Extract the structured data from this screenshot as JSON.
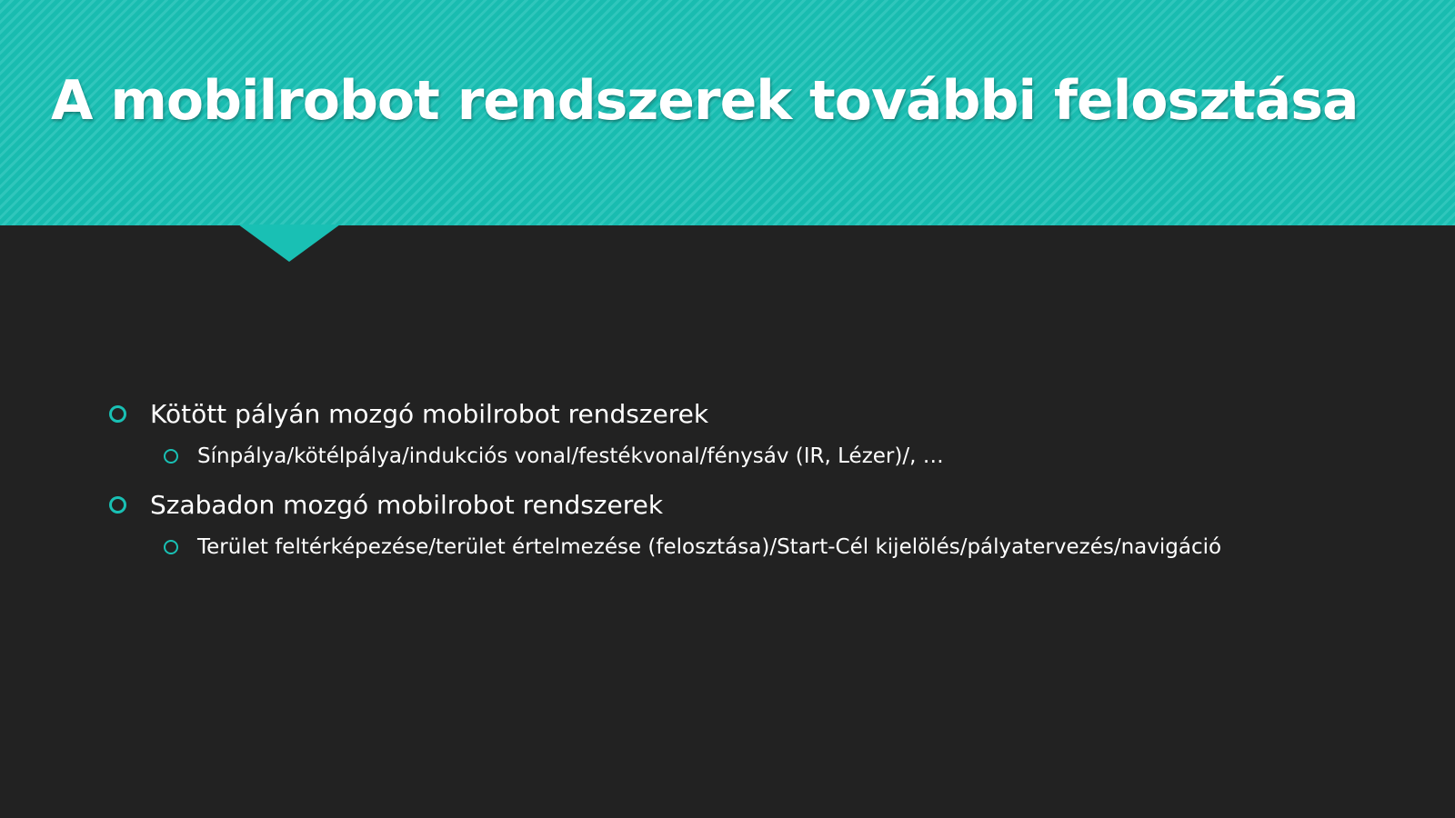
{
  "slide": {
    "title": "A mobilrobot rendszerek további felosztása",
    "accent_color": "#19c0b4",
    "background_color": "#222222",
    "bullets": [
      {
        "text": "Kötött pályán mozgó mobilrobot rendszerek",
        "icon": "ring-bullet-icon",
        "sub": [
          {
            "text": "Sínpálya/kötélpálya/indukciós vonal/festékvonal/fénysáv (IR, Lézer)/, …",
            "icon": "ring-bullet-icon"
          }
        ]
      },
      {
        "text": "Szabadon mozgó mobilrobot rendszerek",
        "icon": "ring-bullet-icon",
        "sub": [
          {
            "text": "Terület feltérképezése/terület értelmezése (felosztása)/Start-Cél kijelölés/pályatervezés/navigáció",
            "icon": "ring-bullet-icon"
          }
        ]
      }
    ]
  }
}
